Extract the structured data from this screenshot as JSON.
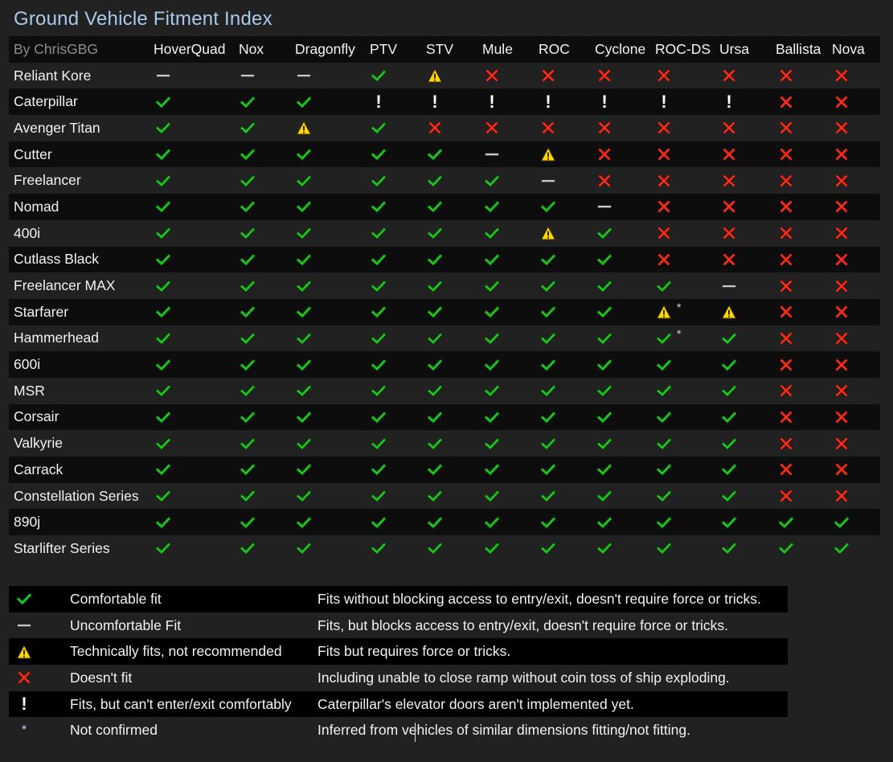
{
  "title": "Ground Vehicle Fitment Index",
  "byline": "By ChrisGBG",
  "colors": {
    "title": "#a9c9ea",
    "check": "#22c322",
    "cross": "#f0301e",
    "warning": "#ffd800",
    "dash": "#c8c8c8",
    "row_dark": "#0d0d0d",
    "background": "#212121"
  },
  "columns": [
    "HoverQuad",
    "Nox",
    "Dragonfly",
    "PTV",
    "STV",
    "Mule",
    "ROC",
    "Cyclone",
    "ROC-DS",
    "Ursa",
    "Ballista",
    "Nova"
  ],
  "rows": [
    {
      "ship": "Reliant Kore",
      "cells": [
        "dash",
        "dash",
        "dash",
        "check",
        "warning",
        "cross",
        "cross",
        "cross",
        "cross",
        "cross",
        "cross",
        "cross"
      ]
    },
    {
      "ship": "Caterpillar",
      "cells": [
        "check",
        "check",
        "check",
        "exclaim",
        "exclaim",
        "exclaim",
        "exclaim",
        "exclaim",
        "exclaim",
        "exclaim",
        "cross",
        "cross"
      ]
    },
    {
      "ship": "Avenger Titan",
      "cells": [
        "check",
        "check",
        "warning",
        "check",
        "cross",
        "cross",
        "cross",
        "cross",
        "cross",
        "cross",
        "cross",
        "cross"
      ]
    },
    {
      "ship": "Cutter",
      "cells": [
        "check",
        "check",
        "check",
        "check",
        "check",
        "dash",
        "warning",
        "cross",
        "cross",
        "cross",
        "cross",
        "cross"
      ]
    },
    {
      "ship": "Freelancer",
      "cells": [
        "check",
        "check",
        "check",
        "check",
        "check",
        "check",
        "dash",
        "cross",
        "cross",
        "cross",
        "cross",
        "cross"
      ]
    },
    {
      "ship": "Nomad",
      "cells": [
        "check",
        "check",
        "check",
        "check",
        "check",
        "check",
        "check",
        "dash",
        "cross",
        "cross",
        "cross",
        "cross"
      ]
    },
    {
      "ship": "400i",
      "cells": [
        "check",
        "check",
        "check",
        "check",
        "check",
        "check",
        "warning",
        "check",
        "cross",
        "cross",
        "cross",
        "cross"
      ]
    },
    {
      "ship": "Cutlass Black",
      "cells": [
        "check",
        "check",
        "check",
        "check",
        "check",
        "check",
        "check",
        "check",
        "cross",
        "cross",
        "cross",
        "cross"
      ]
    },
    {
      "ship": "Freelancer MAX",
      "cells": [
        "check",
        "check",
        "check",
        "check",
        "check",
        "check",
        "check",
        "check",
        "check",
        "dash",
        "cross",
        "cross"
      ]
    },
    {
      "ship": "Starfarer",
      "cells": [
        "check",
        "check",
        "check",
        "check",
        "check",
        "check",
        "check",
        "check",
        "warning*",
        "warning",
        "cross",
        "cross"
      ]
    },
    {
      "ship": "Hammerhead",
      "cells": [
        "check",
        "check",
        "check",
        "check",
        "check",
        "check",
        "check",
        "check",
        "check*",
        "check",
        "cross",
        "cross"
      ]
    },
    {
      "ship": "600i",
      "cells": [
        "check",
        "check",
        "check",
        "check",
        "check",
        "check",
        "check",
        "check",
        "check",
        "check",
        "cross",
        "cross"
      ]
    },
    {
      "ship": "MSR",
      "cells": [
        "check",
        "check",
        "check",
        "check",
        "check",
        "check",
        "check",
        "check",
        "check",
        "check",
        "cross",
        "cross"
      ]
    },
    {
      "ship": "Corsair",
      "cells": [
        "check",
        "check",
        "check",
        "check",
        "check",
        "check",
        "check",
        "check",
        "check",
        "check",
        "cross",
        "cross"
      ]
    },
    {
      "ship": "Valkyrie",
      "cells": [
        "check",
        "check",
        "check",
        "check",
        "check",
        "check",
        "check",
        "check",
        "check",
        "check",
        "cross",
        "cross"
      ]
    },
    {
      "ship": "Carrack",
      "cells": [
        "check",
        "check",
        "check",
        "check",
        "check",
        "check",
        "check",
        "check",
        "check",
        "check",
        "cross",
        "cross"
      ]
    },
    {
      "ship": "Constellation Series",
      "cells": [
        "check",
        "check",
        "check",
        "check",
        "check",
        "check",
        "check",
        "check",
        "check",
        "check",
        "cross",
        "cross"
      ]
    },
    {
      "ship": "890j",
      "cells": [
        "check",
        "check",
        "check",
        "check",
        "check",
        "check",
        "check",
        "check",
        "check",
        "check",
        "check",
        "check"
      ]
    },
    {
      "ship": "Starlifter Series",
      "cells": [
        "check",
        "check",
        "check",
        "check",
        "check",
        "check",
        "check",
        "check",
        "check",
        "check",
        "check",
        "check"
      ]
    }
  ],
  "legend": [
    {
      "icon": "check",
      "icon_name": "check-icon",
      "name": "Comfortable fit",
      "description": "Fits without blocking access to entry/exit, doesn't require force or tricks."
    },
    {
      "icon": "dash",
      "icon_name": "dash-icon",
      "name": "Uncomfortable Fit",
      "description": "Fits, but blocks access to entry/exit, doesn't require force or tricks."
    },
    {
      "icon": "warning",
      "icon_name": "warning-icon",
      "name": "Technically fits, not recommended",
      "description": "Fits but requires force or tricks."
    },
    {
      "icon": "cross",
      "icon_name": "cross-icon",
      "name": "Doesn't fit",
      "description": "Including unable to close ramp without coin toss of ship exploding."
    },
    {
      "icon": "exclaim",
      "icon_name": "exclamation-icon",
      "name": "Fits, but can't enter/exit comfortably",
      "description": "Caterpillar's elevator doors aren't implemented yet."
    },
    {
      "icon": "asterisk",
      "icon_name": "asterisk-icon",
      "name": "Not confirmed",
      "description": "Inferred from vehicles of similar dimensions fitting/not fitting."
    }
  ],
  "glyphs": {
    "exclaim": "!",
    "asterisk": "*"
  }
}
